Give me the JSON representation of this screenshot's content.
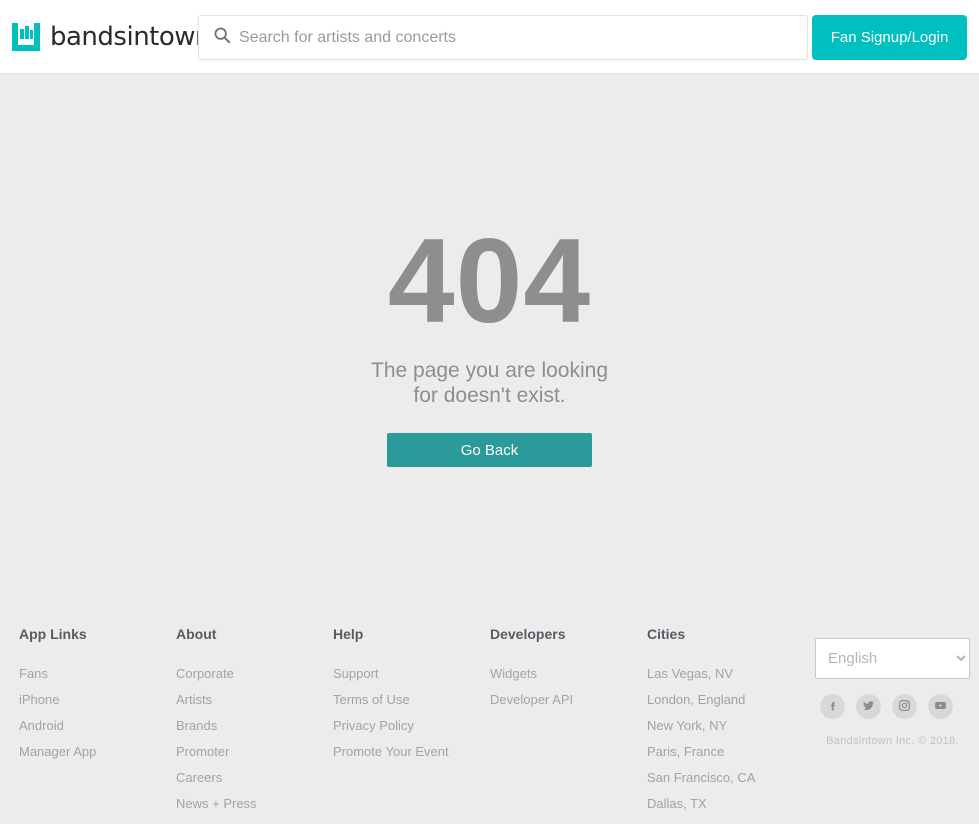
{
  "header": {
    "logo_text": "bandsintown",
    "logo_icon": "bandsintown-logo-icon",
    "search": {
      "icon": "search-icon",
      "placeholder": "Search for artists and concerts",
      "value": ""
    },
    "signup_label": "Fan Signup/Login"
  },
  "main": {
    "error_code": "404",
    "error_message": "The page you are looking for doesn't exist.",
    "go_back_label": "Go Back"
  },
  "footer": {
    "columns": [
      {
        "heading": "App Links",
        "links": [
          "Fans",
          "iPhone",
          "Android",
          "Manager App"
        ]
      },
      {
        "heading": "About",
        "links": [
          "Corporate",
          "Artists",
          "Brands",
          "Promoter",
          "Careers",
          "News + Press"
        ]
      },
      {
        "heading": "Help",
        "links": [
          "Support",
          "Terms of Use",
          "Privacy Policy",
          "Promote Your Event"
        ]
      },
      {
        "heading": "Developers",
        "links": [
          "Widgets",
          "Developer API"
        ]
      },
      {
        "heading": "Cities",
        "links": [
          "Las Vegas, NV",
          "London, England",
          "New York, NY",
          "Paris, France",
          "San Francisco, CA",
          "Dallas, TX"
        ]
      }
    ],
    "language": {
      "selected": "English",
      "options": [
        "English"
      ]
    },
    "social": [
      {
        "name": "facebook-icon",
        "label": "Facebook"
      },
      {
        "name": "twitter-icon",
        "label": "Twitter"
      },
      {
        "name": "instagram-icon",
        "label": "Instagram"
      },
      {
        "name": "youtube-icon",
        "label": "YouTube"
      }
    ],
    "copyright": "Bandsintown Inc. © 2018."
  },
  "colors": {
    "brand_teal": "#00bfbf",
    "button_teal": "#2b9a9a",
    "page_bg": "#ececec",
    "header_bg": "#ffffff",
    "muted_text": "#8e8e8e",
    "link_text": "#a3a3a3",
    "heading_text": "#555c63"
  }
}
